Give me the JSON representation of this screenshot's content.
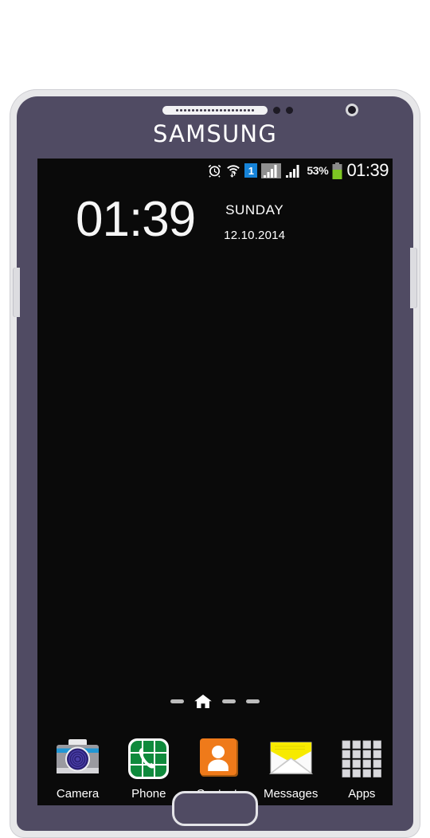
{
  "device": {
    "brand": "SAMSUNG",
    "bezel_color": "#504b63",
    "frame_color": "#e7e7e9",
    "hardware": {
      "speaker_grille": "speaker-grille",
      "proximity_sensor": "proximity-sensor",
      "front_camera": "front-camera-icon",
      "volume_button": "volume-button",
      "power_button": "power-button",
      "home_button": "home-button"
    }
  },
  "statusbar": {
    "alarm_icon": "alarm-clock-icon",
    "wifi_icon": "wifi-transfer-icon",
    "sim_badge": "1",
    "signal1_icon": "signal-bars-sim1-icon",
    "signal2_icon": "signal-bars-sim2-icon",
    "battery_percent": "53%",
    "battery_icon": "battery-icon",
    "battery_level": 53,
    "battery_color": "#7ec623",
    "clock": "01:39"
  },
  "clock_widget": {
    "time": "01:39",
    "day": "SUNDAY",
    "date": "12.10.2014"
  },
  "page_indicator": {
    "home_icon": "home-icon",
    "dots": [
      "dash",
      "home",
      "dash",
      "dash"
    ],
    "current_page": 1,
    "total_pages": 4
  },
  "dock": {
    "items": [
      {
        "label": "Camera",
        "icon": "camera-icon"
      },
      {
        "label": "Phone",
        "icon": "phone-icon"
      },
      {
        "label": "Contacts",
        "icon": "contacts-icon"
      },
      {
        "label": "Messages",
        "icon": "messages-icon"
      },
      {
        "label": "Apps",
        "icon": "apps-grid-icon"
      }
    ]
  }
}
